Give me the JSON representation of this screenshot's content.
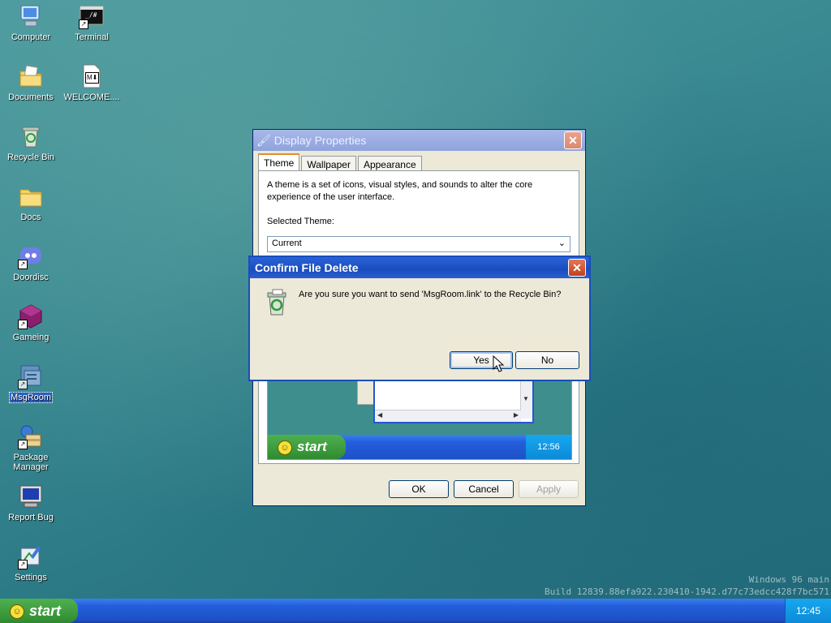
{
  "desktop": {
    "icons": [
      {
        "label": "Computer",
        "icon": "computer-icon"
      },
      {
        "label": "Terminal",
        "icon": "terminal-icon",
        "glyph": "_/#"
      },
      {
        "label": "Documents",
        "icon": "documents-icon"
      },
      {
        "label": "WELCOME....",
        "icon": "markdown-file-icon",
        "glyph": "M⬇"
      },
      {
        "label": "Recycle Bin",
        "icon": "recycle-bin-icon"
      },
      {
        "label": "Docs",
        "icon": "folder-icon"
      },
      {
        "label": "Doordisc",
        "icon": "doordisc-icon"
      },
      {
        "label": "Gameing",
        "icon": "gameing-icon"
      },
      {
        "label": "MsgRoom",
        "icon": "msgroom-icon"
      },
      {
        "label": "Package Manager",
        "icon": "package-manager-icon"
      },
      {
        "label": "Report Bug",
        "icon": "report-bug-icon"
      },
      {
        "label": "Settings",
        "icon": "settings-icon"
      }
    ]
  },
  "display_properties": {
    "title": "Display Properties",
    "close_glyph": "✕",
    "tabs": [
      "Theme",
      "Wallpaper",
      "Appearance"
    ],
    "description": "A theme is a set of icons, visual styles, and sounds to alter the core experience of the user interface.",
    "selected_theme_label": "Selected Theme:",
    "selected_theme_value": "Current",
    "preview": {
      "start_label": "start",
      "clock": "12:56"
    },
    "buttons": {
      "ok": "OK",
      "cancel": "Cancel",
      "apply": "Apply"
    }
  },
  "confirm_dialog": {
    "title": "Confirm File Delete",
    "close_glyph": "✕",
    "message": "Are you sure you want to send 'MsgRoom.link' to the Recycle Bin?",
    "buttons": {
      "yes": "Yes",
      "no": "No"
    }
  },
  "taskbar": {
    "start_label": "start",
    "clock": "12:45"
  },
  "watermark": {
    "line1": "Windows 96 main",
    "line2": "Build 12839.88efa922.230410-1942.d77c73edcc428f7bc571"
  },
  "colors": {
    "title_active": "#1a4dbc",
    "start_green": "#3c9a3c",
    "taskbar_blue": "#245edb"
  }
}
